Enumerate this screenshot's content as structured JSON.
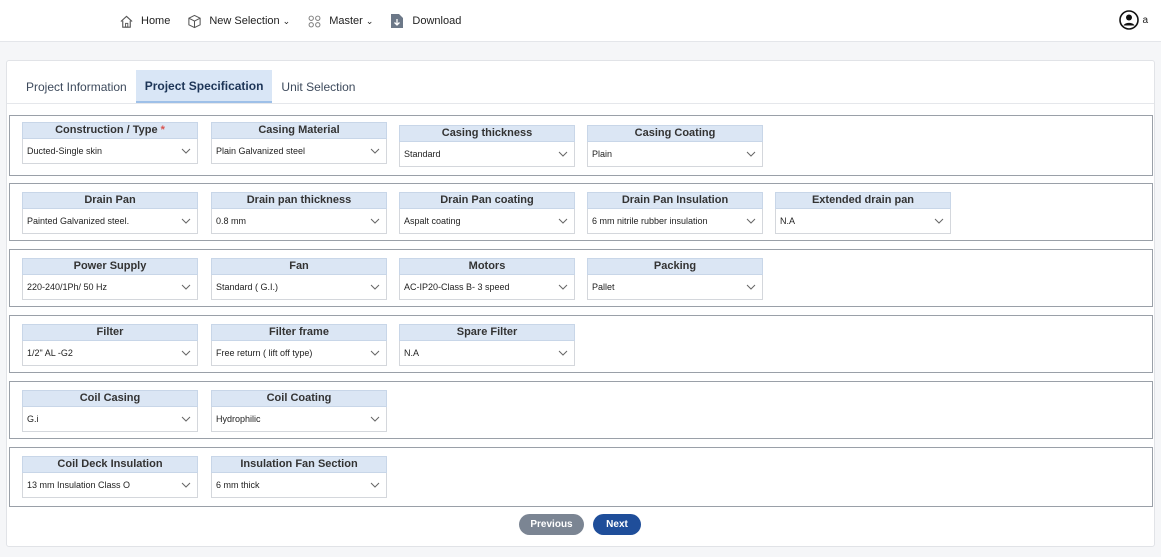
{
  "nav": {
    "items": [
      {
        "label": "Home",
        "icon": "home-icon",
        "dropdown": false
      },
      {
        "label": "New Selection",
        "icon": "cube-icon",
        "dropdown": true
      },
      {
        "label": "Master",
        "icon": "grid-icon",
        "dropdown": true
      },
      {
        "label": "Download",
        "icon": "download-icon",
        "dropdown": false
      }
    ],
    "user_label": "a"
  },
  "tabs": [
    {
      "label": "Project Information",
      "active": false
    },
    {
      "label": "Project Specification",
      "active": true
    },
    {
      "label": "Unit Selection",
      "active": false
    }
  ],
  "sections": [
    {
      "fields": [
        {
          "label": "Construction / Type",
          "required": true,
          "value": "Ducted-Single skin"
        },
        {
          "label": "Casing Material",
          "value": "Plain Galvanized steel"
        },
        {
          "label": "Casing thickness",
          "value": "Standard"
        },
        {
          "label": "Casing Coating",
          "value": "Plain"
        }
      ]
    },
    {
      "fields": [
        {
          "label": "Drain Pan",
          "value": "Painted Galvanized steel."
        },
        {
          "label": "Drain pan thickness",
          "value": "0.8 mm"
        },
        {
          "label": "Drain Pan coating",
          "value": "Aspalt coating"
        },
        {
          "label": "Drain Pan Insulation",
          "value": "6 mm nitrile rubber insulation"
        },
        {
          "label": "Extended drain pan",
          "value": "N.A"
        }
      ]
    },
    {
      "fields": [
        {
          "label": "Power Supply",
          "value": "220-240/1Ph/ 50 Hz"
        },
        {
          "label": "Fan",
          "value": "Standard ( G.I.)"
        },
        {
          "label": "Motors",
          "value": "AC-IP20-Class B- 3 speed"
        },
        {
          "label": "Packing",
          "value": "Pallet"
        }
      ]
    },
    {
      "fields": [
        {
          "label": "Filter",
          "value": "1/2\" AL -G2"
        },
        {
          "label": "Filter frame",
          "value": "Free return ( lift off type)"
        },
        {
          "label": "Spare Filter",
          "value": "N.A"
        }
      ]
    },
    {
      "fields": [
        {
          "label": "Coil Casing",
          "value": "G.i"
        },
        {
          "label": "Coil Coating",
          "value": "Hydrophilic"
        }
      ]
    },
    {
      "fields": [
        {
          "label": "Coil Deck Insulation",
          "value": "13 mm Insulation Class O"
        },
        {
          "label": "Insulation Fan Section",
          "value": "6 mm thick"
        }
      ]
    }
  ],
  "buttons": {
    "previous": "Previous",
    "next": "Next"
  },
  "colors": {
    "accent": "#1f4e9a",
    "tab_active_bg": "#d9e6f6",
    "label_bg": "#dbe6f4",
    "required": "#d9534f"
  }
}
